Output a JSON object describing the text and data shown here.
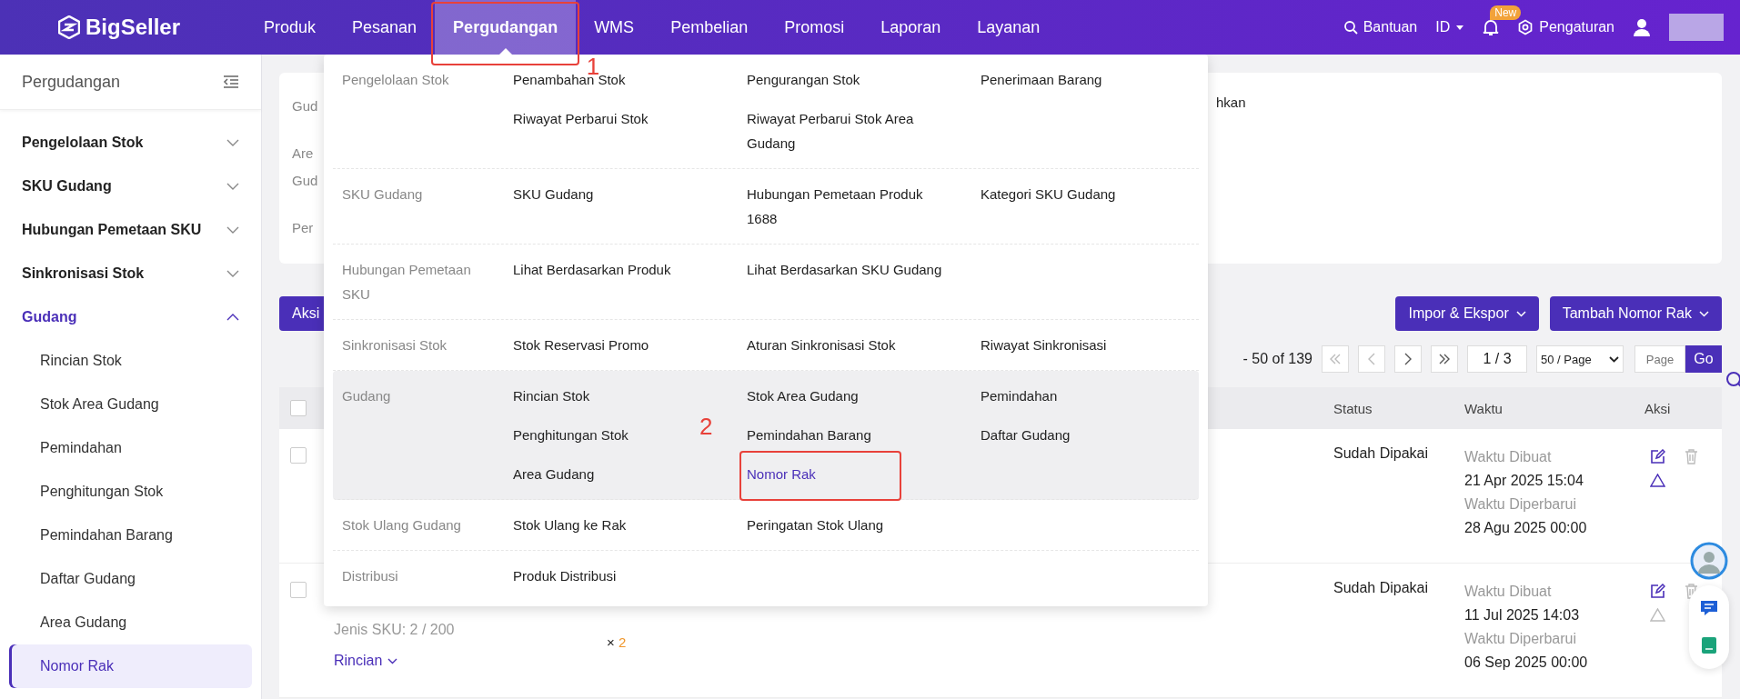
{
  "header": {
    "logo": "BigSeller",
    "nav": [
      {
        "label": "Produk",
        "selected": false
      },
      {
        "label": "Pesanan",
        "selected": false
      },
      {
        "label": "Pergudangan",
        "selected": true,
        "annotation": "1"
      },
      {
        "label": "WMS",
        "selected": false
      },
      {
        "label": "Pembelian",
        "selected": false
      },
      {
        "label": "Promosi",
        "selected": false
      },
      {
        "label": "Laporan",
        "selected": false
      },
      {
        "label": "Layanan",
        "selected": false
      }
    ],
    "help": "Bantuan",
    "language": "ID",
    "badge": "New",
    "settings": "Pengaturan"
  },
  "sidebar": {
    "title": "Pergudangan",
    "groups": [
      {
        "label": "Pengelolaan Stok",
        "expanded": false
      },
      {
        "label": "SKU Gudang",
        "expanded": false
      },
      {
        "label": "Hubungan Pemetaan SKU",
        "expanded": false
      },
      {
        "label": "Sinkronisasi Stok",
        "expanded": false
      },
      {
        "label": "Gudang",
        "expanded": true,
        "children": [
          {
            "label": "Rincian Stok",
            "selected": false
          },
          {
            "label": "Stok Area Gudang",
            "selected": false
          },
          {
            "label": "Pemindahan",
            "selected": false
          },
          {
            "label": "Penghitungan Stok",
            "selected": false
          },
          {
            "label": "Pemindahan Barang",
            "selected": false
          },
          {
            "label": "Daftar Gudang",
            "selected": false
          },
          {
            "label": "Area Gudang",
            "selected": false
          },
          {
            "label": "Nomor Rak",
            "selected": true
          }
        ]
      }
    ]
  },
  "filter_card": {
    "labels": [
      "Gud",
      "Are Gud",
      "Per"
    ],
    "right_fragment": "hkan"
  },
  "toolbar": {
    "action_button": "Aksi",
    "buttons": [
      "Impor & Ekspor",
      "Tambah Nomor Rak"
    ]
  },
  "pagination": {
    "range": "- 50 of 139",
    "page": "1 / 3",
    "page_size": "50 / Page",
    "jump_placeholder": "Page",
    "go": "Go"
  },
  "table": {
    "all_checked": false,
    "columns": [
      "Status",
      "Waktu",
      "Aksi"
    ],
    "rows": [
      {
        "checked": false,
        "status": "Sudah Dipakai",
        "created_label": "Waktu Dibuat",
        "created": "21 Apr 2025 15:04",
        "updated_label": "Waktu Diperbarui",
        "updated": "28 Agu 2025 00:00",
        "action_enabled": true
      },
      {
        "checked": false,
        "sku_info": "Jenis SKU: 2 / 200",
        "detail_link": "Rincian",
        "quantity_sign": "×",
        "quantity": "2",
        "status": "Sudah Dipakai",
        "created_label": "Waktu Dibuat",
        "created": "11 Jul 2025 14:03",
        "updated_label": "Waktu Diperbarui",
        "updated": "06 Sep 2025 00:00",
        "action_enabled": false
      }
    ]
  },
  "mega_menu": {
    "groups": [
      {
        "label": "Pengelolaan Stok",
        "active": false,
        "items": [
          {
            "label": "Penambahan Stok",
            "selected": false
          },
          {
            "label": "Pengurangan Stok",
            "selected": false
          },
          {
            "label": "Penerimaan Barang",
            "selected": false
          },
          {
            "label": "Riwayat Perbarui Stok",
            "selected": false
          },
          {
            "label": "Riwayat Perbarui Stok Area Gudang",
            "selected": false
          }
        ]
      },
      {
        "label": "SKU Gudang",
        "active": false,
        "items": [
          {
            "label": "SKU Gudang",
            "selected": false
          },
          {
            "label": "Hubungan Pemetaan Produk 1688",
            "selected": false
          },
          {
            "label": "Kategori SKU Gudang",
            "selected": false
          }
        ]
      },
      {
        "label": "Hubungan Pemetaan SKU",
        "active": false,
        "items": [
          {
            "label": "Lihat Berdasarkan Produk",
            "selected": false
          },
          {
            "label": "Lihat Berdasarkan SKU Gudang",
            "selected": false
          }
        ]
      },
      {
        "label": "Sinkronisasi Stok",
        "active": false,
        "items": [
          {
            "label": "Stok Reservasi Promo",
            "selected": false
          },
          {
            "label": "Aturan Sinkronisasi Stok",
            "selected": false
          },
          {
            "label": "Riwayat Sinkronisasi",
            "selected": false
          }
        ]
      },
      {
        "label": "Gudang",
        "active": true,
        "items": [
          {
            "label": "Rincian Stok",
            "selected": false
          },
          {
            "label": "Stok Area Gudang",
            "selected": false
          },
          {
            "label": "Pemindahan",
            "selected": false
          },
          {
            "label": "Penghitungan Stok",
            "selected": false
          },
          {
            "label": "Pemindahan Barang",
            "selected": false
          },
          {
            "label": "Daftar Gudang",
            "selected": false
          },
          {
            "label": "Area Gudang",
            "selected": false
          },
          {
            "label": "Nomor Rak",
            "selected": true,
            "annotation": "2"
          }
        ]
      },
      {
        "label": "Stok Ulang Gudang",
        "active": false,
        "items": [
          {
            "label": "Stok Ulang ke Rak",
            "selected": false
          },
          {
            "label": "Peringatan Stok Ulang",
            "selected": false
          }
        ]
      },
      {
        "label": "Distribusi",
        "active": false,
        "items": [
          {
            "label": "Produk Distribusi",
            "selected": false
          }
        ]
      }
    ]
  }
}
